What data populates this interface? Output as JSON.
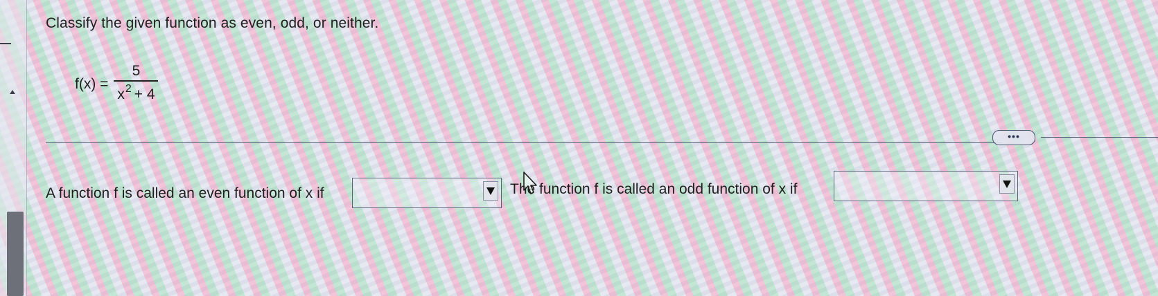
{
  "question": {
    "prompt": "Classify the given function as even, odd, or neither.",
    "function_name": "f(x) =",
    "numerator": "5",
    "denominator_base": "x",
    "denominator_exponent": "2",
    "denominator_rest": "+ 4"
  },
  "more_button_label": "•••",
  "answers": {
    "even_prompt": "A function f is called an even function of x if",
    "even_selected": "",
    "odd_prompt": "The function f is called an odd function of x if",
    "odd_selected": ""
  }
}
